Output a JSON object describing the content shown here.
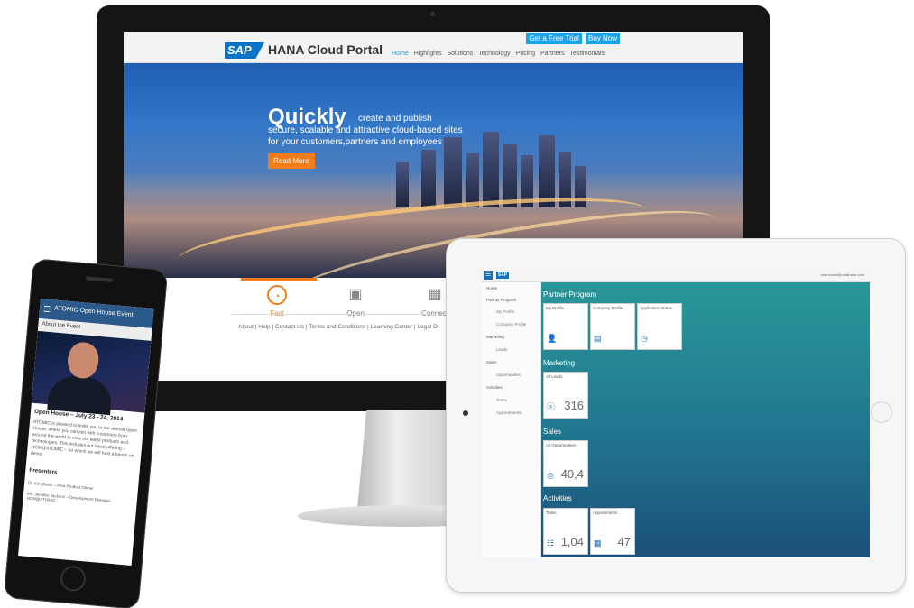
{
  "desktop_site": {
    "brand": "SAP",
    "title": "HANA Cloud Portal",
    "cta_trial": "Get a Free Trial",
    "cta_buy": "Buy Now",
    "nav": [
      "Home",
      "Highlights",
      "Solutions",
      "Technology",
      "Pricing",
      "Partners",
      "Testimonials"
    ],
    "hero_word": "Quickly",
    "hero_rest": "create and publish",
    "hero_line2": "secure, scalable and attractive cloud-based sites",
    "hero_line3": "for your customers,partners and employees",
    "read_more": "Read More",
    "features": [
      "Fast",
      "Open",
      "Connect"
    ],
    "footer": "About | Help | Contact Us | Terms and Conditions | Learning Center | Legal D"
  },
  "tablet_app": {
    "brand": "SAP",
    "user": "user.name@mailinator.com",
    "sidebar": [
      "Home",
      "Partner Program",
      "My Profile",
      "Company Profile",
      "Marketing",
      "Leads",
      "Sales",
      "Opportunities",
      "Activities",
      "Tasks",
      "Appointments"
    ],
    "sections": [
      "Partner Program",
      "Marketing",
      "Sales",
      "Activities"
    ],
    "tiles": {
      "my_profile": "My Profile",
      "company_profile": "Company Profile",
      "application_status": "Application Status",
      "all_leads": "All Leads",
      "all_leads_value": "316",
      "all_opportunities": "All Opportunities",
      "all_opportunities_value": "40,4",
      "tasks": "Tasks",
      "tasks_value": "1,04",
      "appointments": "Appointments",
      "appointments_value": "47"
    }
  },
  "phone_app": {
    "title": "ATOMIC Open House Event",
    "about": "About the Event",
    "heading": "Open House – July 23 - 24, 2014",
    "paragraph": "ATOMIC is pleased to invite you to our annual Open House, where you can join with customers from around the world to view our latest products and technologies. This includes our latest offering – HCM@ATOMIC – for which we will hold a hands on demo",
    "presenters": "Presenters",
    "presenter1": "Dr. Kim Davis – Area Product Owner",
    "presenter2": "Ms. Jennifer Jackson – Development Manager, HCM@ATOMIC"
  },
  "colors": {
    "accent_orange": "#f07d1a",
    "sap_blue": "#0b73c8",
    "cta_blue": "#1aa3e8",
    "tablet_teal": "#2a9a9a"
  }
}
